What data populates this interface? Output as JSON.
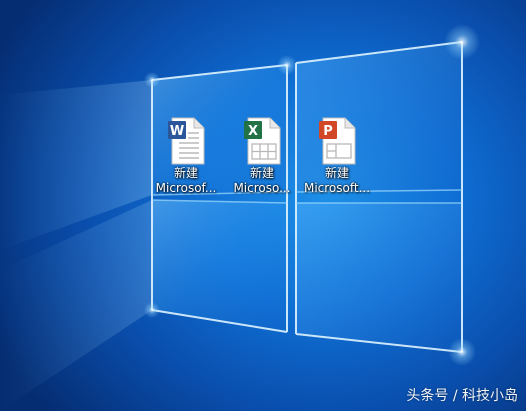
{
  "desktop": {
    "icons": [
      {
        "line1": "新建",
        "line2": "Microsof...",
        "type": "word-document-icon",
        "accent": "#2b579a"
      },
      {
        "line1": "新建",
        "line2": "Microso...",
        "type": "excel-spreadsheet-icon",
        "accent": "#217346"
      },
      {
        "line1": "新建",
        "line2": "Microsoft...",
        "type": "powerpoint-presentation-icon",
        "accent": "#d24726"
      }
    ]
  },
  "watermark": "头条号 / 科技小岛"
}
